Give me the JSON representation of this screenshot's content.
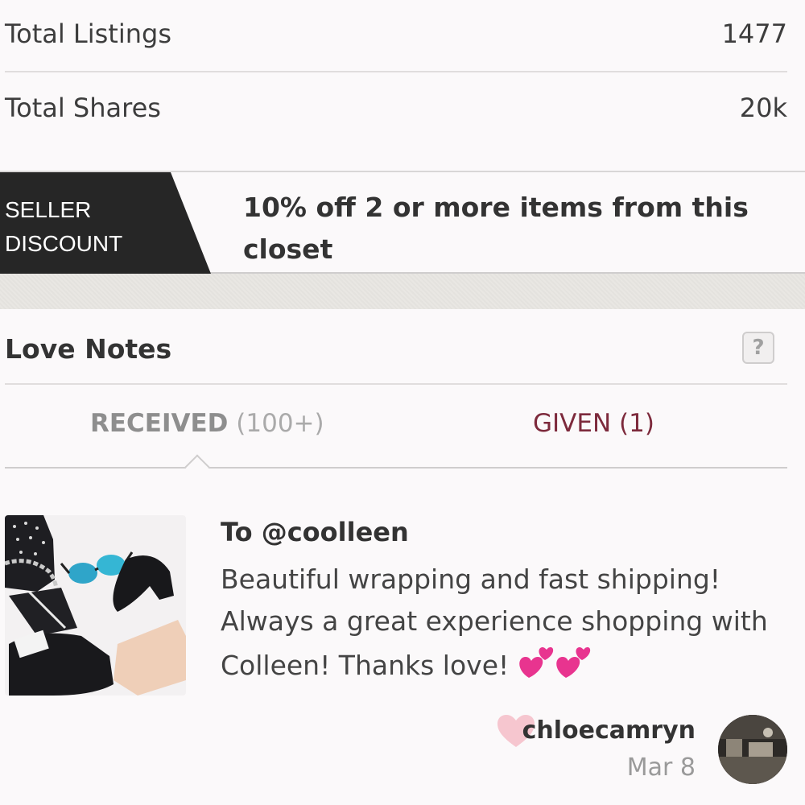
{
  "stats": {
    "listings": {
      "label": "Total Listings",
      "value": "1477"
    },
    "shares": {
      "label": "Total Shares",
      "value": "20k"
    }
  },
  "discount": {
    "tag_line1": "SELLER",
    "tag_line2": "DISCOUNT",
    "text": "10% off 2 or more items from this closet"
  },
  "love_notes": {
    "title": "Love Notes",
    "help_label": "?",
    "tabs": {
      "received_label": "RECEIVED",
      "received_count": "(100+)",
      "given": "GIVEN (1)"
    },
    "note": {
      "to": "To @coolleen",
      "body": "Beautiful wrapping and fast shipping! Always a great experience shopping with Colleen! Thanks love!",
      "author": "chloecamryn",
      "date": "Mar 8",
      "icons": [
        "heart-emoji",
        "heart-emoji",
        "heart-icon",
        "avatar"
      ]
    }
  },
  "colors": {
    "accent": "#7d2a3c",
    "tag_bg": "#262626",
    "heart": "#f6c6cf"
  }
}
